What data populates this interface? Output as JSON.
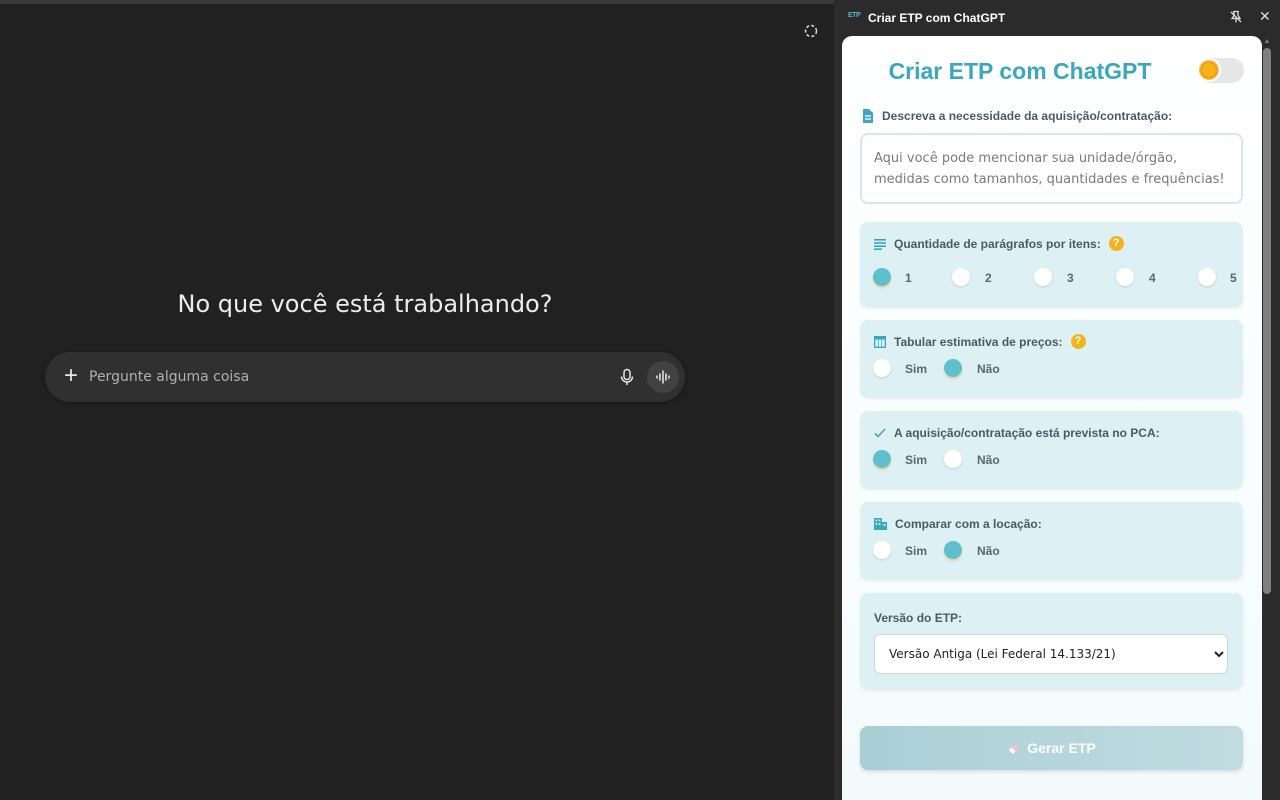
{
  "chat": {
    "greeting": "No que você está trabalhando?",
    "composer_placeholder": "Pergunte alguma coisa"
  },
  "panel_header": {
    "logo_text": "ETP",
    "title": "Criar ETP com ChatGPT"
  },
  "panel": {
    "heading": "Criar ETP com ChatGPT",
    "need": {
      "label": "Descreva a necessidade da aquisição/contratação:",
      "placeholder": "Aqui você pode mencionar sua unidade/órgão, medidas como tamanhos, quantidades e frequências!"
    },
    "paragraphs": {
      "label": "Quantidade de parágrafos por itens:",
      "help": "?",
      "options": [
        "1",
        "2",
        "3",
        "4",
        "5"
      ],
      "selected": "1"
    },
    "prices": {
      "label": "Tabular estimativa de preços:",
      "help": "?",
      "yes": "Sim",
      "no": "Não",
      "selected": "Não"
    },
    "pca": {
      "label": "A aquisição/contratação está prevista no PCA:",
      "yes": "Sim",
      "no": "Não",
      "selected": "Sim"
    },
    "rental": {
      "label": "Comparar com a locação:",
      "yes": "Sim",
      "no": "Não",
      "selected": "Não"
    },
    "version": {
      "label": "Versão do ETP:",
      "selected": "Versão Antiga (Lei Federal 14.133/21)"
    },
    "generate_label": "Gerar ETP"
  },
  "colors": {
    "accent": "#3aa7bd",
    "card_bg": "#ddf1f5",
    "radio_on": "#5ec0cd",
    "help_badge": "#f3b41b",
    "chat_bg": "#212121"
  }
}
